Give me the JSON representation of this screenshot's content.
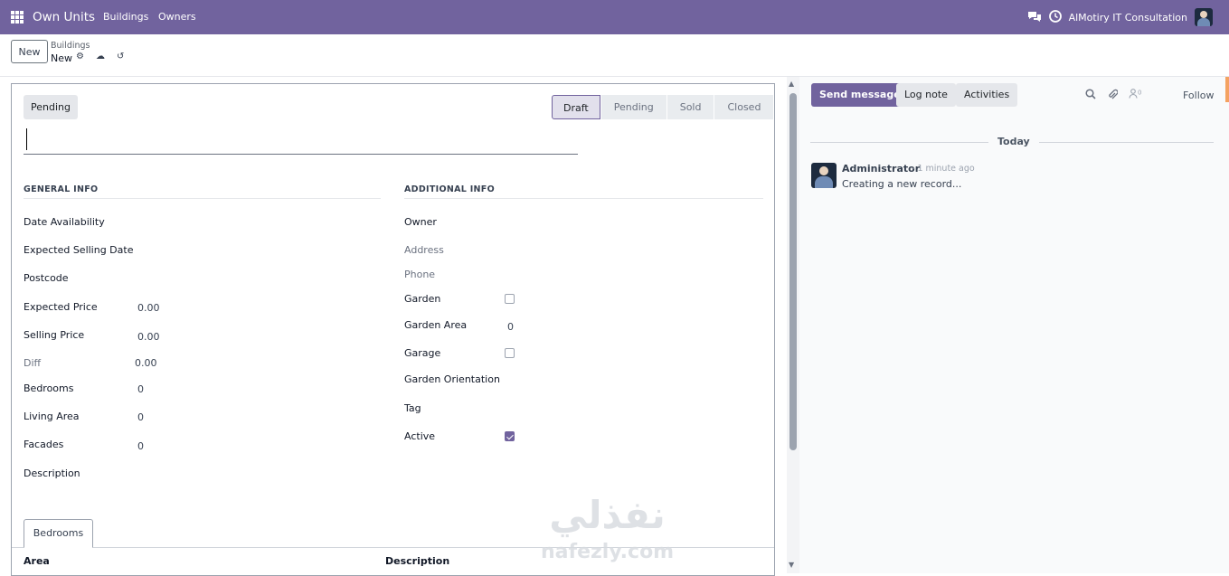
{
  "navbar": {
    "app_name": "Own Units",
    "menu": [
      "Buildings",
      "Owners"
    ],
    "company": "AlMotiry IT Consultation",
    "color": "#71639e"
  },
  "control_panel": {
    "new_button": "New",
    "breadcrumb_parent": "Buildings",
    "breadcrumb_current": "New"
  },
  "form": {
    "pending_button": "Pending",
    "statusbar": [
      "Draft",
      "Pending",
      "Sold",
      "Closed"
    ],
    "active_stage": "Draft",
    "general_info": {
      "title": "GENERAL INFO",
      "fields": [
        {
          "label": "Date Availability",
          "value": ""
        },
        {
          "label": "Expected Selling Date",
          "value": ""
        },
        {
          "label": "Postcode",
          "value": ""
        },
        {
          "label": "Expected Price",
          "value": "0.00"
        },
        {
          "label": "Selling Price",
          "value": "0.00"
        },
        {
          "label": "Diff",
          "value": "0.00"
        },
        {
          "label": "Bedrooms",
          "value": "0"
        },
        {
          "label": "Living Area",
          "value": "0"
        },
        {
          "label": "Facades",
          "value": "0"
        },
        {
          "label": "Description",
          "value": ""
        }
      ]
    },
    "additional_info": {
      "title": "ADDITIONAL INFO",
      "fields": [
        {
          "label": "Owner",
          "value": ""
        },
        {
          "label": "Address",
          "value": ""
        },
        {
          "label": "Phone",
          "value": ""
        },
        {
          "label": "Garden",
          "checked": false
        },
        {
          "label": "Garden Area",
          "value": "0"
        },
        {
          "label": "Garage",
          "checked": false
        },
        {
          "label": "Garden Orientation",
          "value": ""
        },
        {
          "label": "Tag",
          "value": ""
        },
        {
          "label": "Active",
          "checked": true
        }
      ]
    },
    "tabs": [
      "Bedrooms"
    ],
    "table_headers": [
      "Area",
      "Description"
    ]
  },
  "chatter": {
    "send_message": "Send message",
    "log_note": "Log note",
    "activities": "Activities",
    "follower_count": "0",
    "follow": "Follow",
    "date_separator": "Today",
    "messages": [
      {
        "author": "Administrator",
        "time": "- 1 minute ago",
        "body": "Creating a new record..."
      }
    ]
  },
  "watermark": {
    "arabic": "نفذلي",
    "latin": "nafezly.com"
  }
}
